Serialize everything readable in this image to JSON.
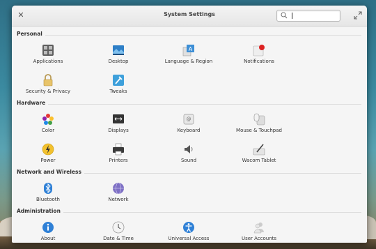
{
  "window": {
    "title": "System Settings",
    "search_value": "",
    "search_placeholder": ""
  },
  "sections": [
    {
      "label": "Personal",
      "items": [
        {
          "label": "Applications",
          "icon": "applications-icon"
        },
        {
          "label": "Desktop",
          "icon": "desktop-icon"
        },
        {
          "label": "Language & Region",
          "icon": "language-region-icon"
        },
        {
          "label": "Notifications",
          "icon": "notifications-icon"
        },
        {
          "label": "Security & Privacy",
          "icon": "lock-icon"
        },
        {
          "label": "Tweaks",
          "icon": "tweaks-icon"
        }
      ]
    },
    {
      "label": "Hardware",
      "items": [
        {
          "label": "Color",
          "icon": "color-icon"
        },
        {
          "label": "Displays",
          "icon": "displays-icon"
        },
        {
          "label": "Keyboard",
          "icon": "keyboard-icon"
        },
        {
          "label": "Mouse & Touchpad",
          "icon": "mouse-icon"
        },
        {
          "label": "Power",
          "icon": "power-icon"
        },
        {
          "label": "Printers",
          "icon": "printer-icon"
        },
        {
          "label": "Sound",
          "icon": "sound-icon"
        },
        {
          "label": "Wacom Tablet",
          "icon": "wacom-tablet-icon"
        }
      ]
    },
    {
      "label": "Network and Wireless",
      "items": [
        {
          "label": "Bluetooth",
          "icon": "bluetooth-icon"
        },
        {
          "label": "Network",
          "icon": "network-icon"
        }
      ]
    },
    {
      "label": "Administration",
      "items": [
        {
          "label": "About",
          "icon": "about-icon"
        },
        {
          "label": "Date & Time",
          "icon": "clock-icon"
        },
        {
          "label": "Universal Access",
          "icon": "accessibility-icon"
        },
        {
          "label": "User Accounts",
          "icon": "user-accounts-icon"
        }
      ]
    }
  ]
}
